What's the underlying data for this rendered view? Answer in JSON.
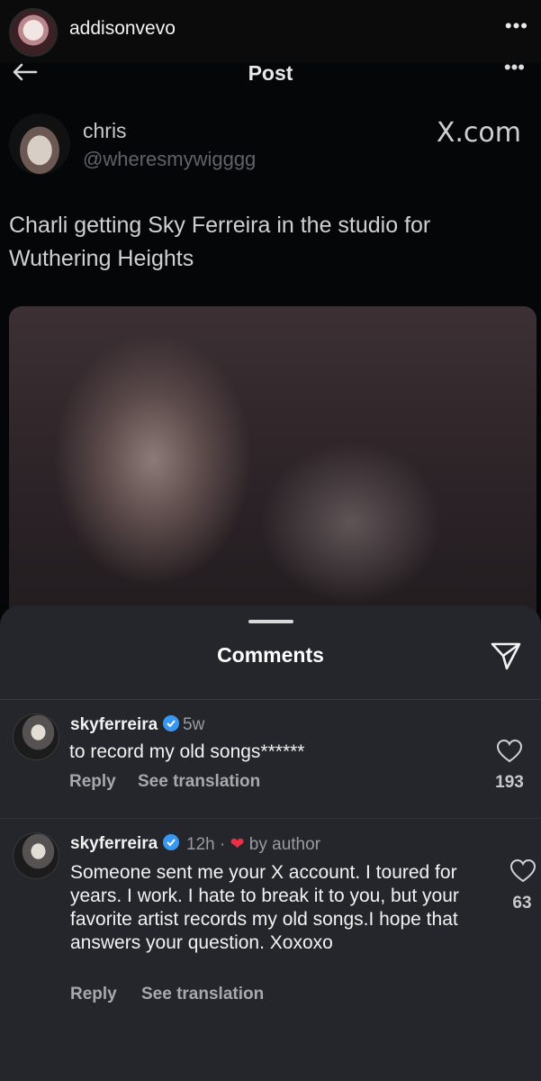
{
  "ig": {
    "username": "addisonvevo",
    "more": "•••"
  },
  "post": {
    "title": "Post",
    "more": "•••",
    "author_name": "chris",
    "author_handle": "@wheresmywigggg",
    "source": "X.com",
    "text": "Charli getting Sky Ferreira in the studio for Wuthering Heights"
  },
  "sheet": {
    "title": "Comments"
  },
  "comments": [
    {
      "user": "skyferreira",
      "time": "5w",
      "text": "to record my old songs******",
      "reply": "Reply",
      "translate": "See translation",
      "likes": "193"
    },
    {
      "user": "skyferreira",
      "time": "12h ·",
      "badge": "by author",
      "text": "Someone sent me your X account. I toured for years. I work. I hate to break it to you, but your favorite artist records my old songs.I hope that answers your question. Xoxoxo",
      "reply": "Reply",
      "translate": "See translation",
      "likes": "63"
    }
  ],
  "colors": {
    "accent_heart": "#ed2f46",
    "verified": "#3897f0",
    "sheet_bg": "#25262b"
  }
}
